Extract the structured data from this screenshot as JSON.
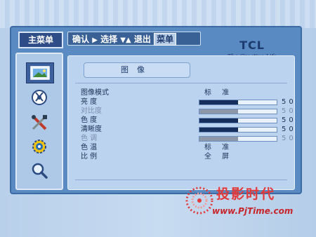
{
  "sidebar": {
    "title": "主菜单",
    "icons": [
      "picture-icon",
      "sound-icon",
      "tools-icon",
      "settings-gear-icon",
      "search-magnifier-icon"
    ]
  },
  "topbar": {
    "confirm": "确认",
    "select": "选择",
    "exit": "退出",
    "menu_tag": "菜单"
  },
  "logo": {
    "brand": "TCL",
    "tagline": "~The Creative Life~"
  },
  "panel": {
    "header": "图像",
    "rows": [
      {
        "label": "图像模式",
        "value": "标 准"
      },
      {
        "label": "亮  度",
        "level": 0.5,
        "number": "50"
      },
      {
        "label": "对比度",
        "level": 0.5,
        "number": "50",
        "dim": true
      },
      {
        "label": "色  度",
        "level": 0.5,
        "number": "50"
      },
      {
        "label": "清晰度",
        "level": 0.5,
        "number": "50"
      },
      {
        "label": "色  调",
        "level": 0.5,
        "number": "50",
        "dim": true
      },
      {
        "label": "色  温",
        "value": "标 准"
      },
      {
        "label": "比  例",
        "value": "全 屏"
      }
    ]
  },
  "watermark": {
    "text": "投影时代",
    "url": "www.PjTime.com"
  },
  "colors": {
    "frame": "#5a8ac2",
    "panel": "#bcd3ef",
    "bar_fill": "#152e5c",
    "watermark": "#e23a3a"
  }
}
